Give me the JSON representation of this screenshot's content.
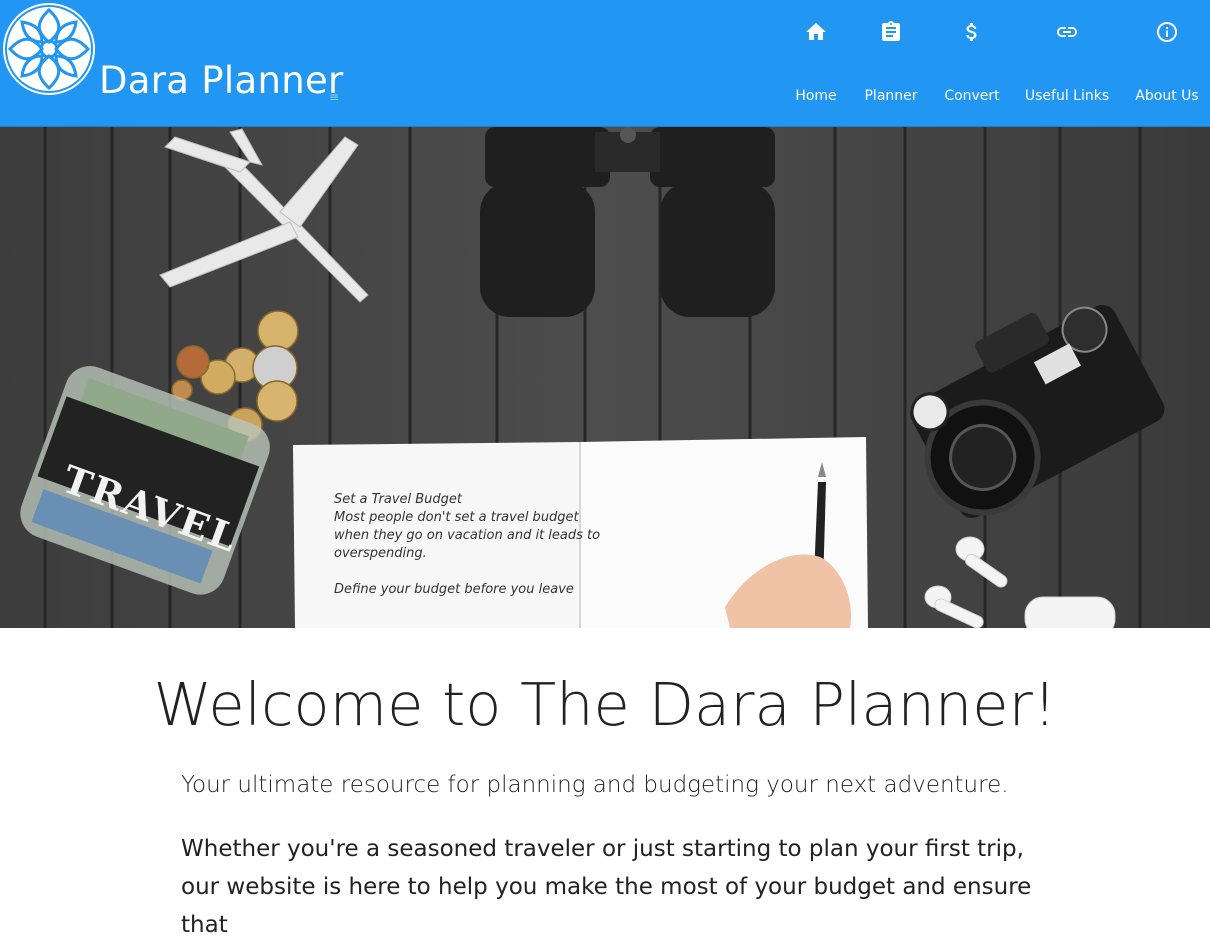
{
  "brand": {
    "name": "Dara Planner",
    "logo_icon": "celtic-knot-logo",
    "menu_icon": "hamburger-icon"
  },
  "nav": {
    "items": [
      {
        "label": "Home",
        "icon": "home-icon"
      },
      {
        "label": "Planner",
        "icon": "clipboard-icon"
      },
      {
        "label": "Convert",
        "icon": "dollar-icon"
      },
      {
        "label": "Useful Links",
        "icon": "link-icon"
      },
      {
        "label": "About Us",
        "icon": "info-icon"
      }
    ]
  },
  "hero": {
    "note_lines": [
      "Set a Travel Budget",
      "Most people don't set a travel budget",
      "when they go on vacation and it leads to",
      "overspending.",
      "",
      "Define your budget before you leave"
    ],
    "jar_label": "TRAVEL"
  },
  "main": {
    "title": "Welcome to The Dara Planner!",
    "lead": "Your ultimate resource for planning and budgeting your next adventure.",
    "paragraph": "Whether you're a seasoned traveler or just starting to plan your first trip, our website is here to help you make the most of your budget and ensure that"
  },
  "colors": {
    "navbar": "#2196f3",
    "text": "#222222",
    "nav_text": "#ffffff"
  }
}
